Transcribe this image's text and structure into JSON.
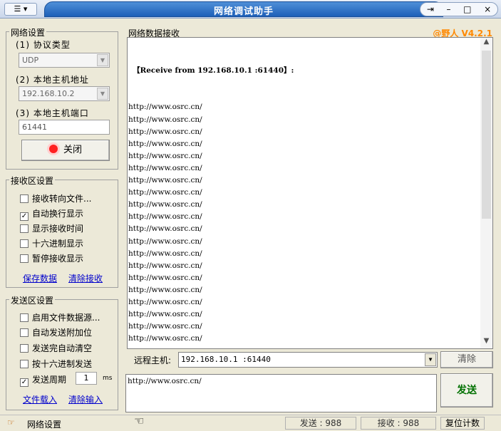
{
  "window": {
    "title": "网络调试助手",
    "sysmenu_label": "☰ ▾",
    "buttons": [
      "⇥",
      "–",
      "□",
      "×"
    ]
  },
  "network_settings": {
    "group_label": "网络设置",
    "protocol_label": "(1) 协议类型",
    "protocol_value": "UDP",
    "host_label": "(2) 本地主机地址",
    "host_value": "192.168.10.2",
    "port_label": "(3) 本地主机端口",
    "port_value": "61441",
    "close_button": "关闭"
  },
  "receive_settings": {
    "group_label": "接收区设置",
    "options": [
      {
        "label": "接收转向文件...",
        "checked": false
      },
      {
        "label": "自动换行显示",
        "checked": true
      },
      {
        "label": "显示接收时间",
        "checked": false
      },
      {
        "label": "十六进制显示",
        "checked": false
      },
      {
        "label": "暂停接收显示",
        "checked": false
      }
    ],
    "save_link": "保存数据",
    "clear_link": "清除接收"
  },
  "send_settings": {
    "group_label": "发送区设置",
    "options": [
      {
        "label": "启用文件数据源...",
        "checked": false
      },
      {
        "label": "自动发送附加位",
        "checked": false
      },
      {
        "label": "发送完自动清空",
        "checked": false
      },
      {
        "label": "按十六进制发送",
        "checked": false
      }
    ],
    "period_label": "发送周期",
    "period_checked": true,
    "period_value": "1",
    "period_unit": "ms",
    "load_link": "文件载入",
    "clear_link": "清除输入"
  },
  "receive_area": {
    "label": "网络数据接收",
    "version": "@野人 V4.2.1",
    "header_line": "【Receive from 192.168.10.1 :61440】:",
    "line": "http://www.osrc.cn/",
    "line_count": 25
  },
  "remote": {
    "label": "远程主机:",
    "value": "192.168.10.1 :61440",
    "clear_button": "清除"
  },
  "send_area": {
    "text": "http://www.osrc.cn/",
    "send_button": "发送"
  },
  "statusbar": {
    "left_label": "网络设置",
    "sent_label": "发送 : 988",
    "recv_label": "接收 : 988",
    "reset_button": "复位计数"
  }
}
